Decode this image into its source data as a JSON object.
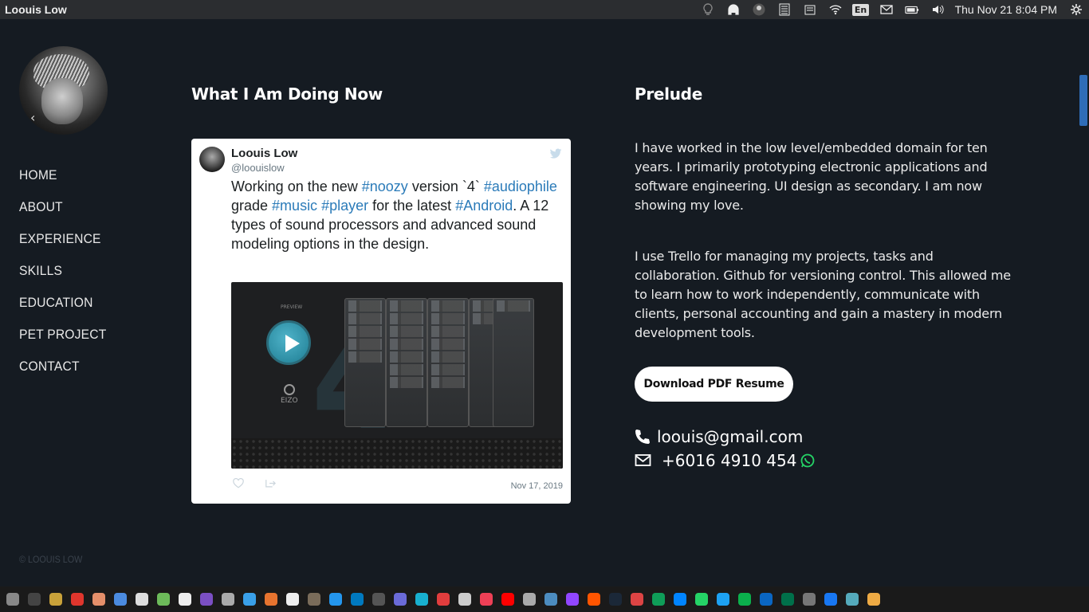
{
  "panel": {
    "title": "Loouis Low",
    "clock": "Thu Nov 21  8:04 PM",
    "lang": "En",
    "tray_icons": [
      "bulb-icon",
      "headphones-icon",
      "user-avatar-icon",
      "notes-icon",
      "clipboard-icon",
      "wifi-icon",
      "keyboard-layout-icon",
      "mail-icon",
      "battery-icon",
      "volume-icon",
      "settings-icon"
    ]
  },
  "sidebar": {
    "nav": [
      "HOME",
      "ABOUT",
      "EXPERIENCE",
      "SKILLS",
      "EDUCATION",
      "PET PROJECT",
      "CONTACT"
    ],
    "copyright": "© LOOUIS LOW"
  },
  "now": {
    "heading": "What I Am Doing Now",
    "tweet": {
      "name": "Loouis Low",
      "handle": "@loouislow",
      "text_parts": [
        {
          "t": "Working on the new ",
          "tag": false
        },
        {
          "t": "#noozy",
          "tag": true
        },
        {
          "t": " version `4` ",
          "tag": false
        },
        {
          "t": "#audiophile",
          "tag": true
        },
        {
          "t": " grade ",
          "tag": false
        },
        {
          "t": "#music",
          "tag": true
        },
        {
          "t": " ",
          "tag": false
        },
        {
          "t": "#player",
          "tag": true
        },
        {
          "t": " for the latest ",
          "tag": false
        },
        {
          "t": "#Android",
          "tag": true
        },
        {
          "t": ". A 12 types of sound processors and advanced sound modeling options in the design.",
          "tag": false
        }
      ],
      "media_label_preview": "PREVIEW",
      "media_label_brand": "EIZO",
      "media_big_numeral": "4",
      "date": "Nov 17, 2019"
    }
  },
  "prelude": {
    "heading": "Prelude",
    "para1": "I have worked in the low level/embedded domain for ten years. I primarily prototyping electronic applications and software engineering. UI design as secondary. I am now showing my love.",
    "para2": "I use Trello for managing my projects, tasks and collaboration. Github for versioning control. This allowed me to learn how to work independently, communicate with clients, personal accounting and gain a mastery in modern development tools.",
    "button": "Download PDF Resume",
    "email": "loouis@gmail.com",
    "phone": "+6016 4910 454"
  },
  "colors": {
    "background": "#151b22",
    "hashtag": "#2b7bb9",
    "whatsapp": "#25d366",
    "scroll_thumb": "#2f6db8"
  },
  "dock": {
    "apps": [
      "settings-icon",
      "terminal-icon",
      "files-icon",
      "opera-icon",
      "app-icon",
      "chrome-icon",
      "headphones-icon",
      "android-studio-icon",
      "editor-icon",
      "tor-icon",
      "tools-icon",
      "box-icon",
      "brave-icon",
      "github-icon",
      "gimp-icon",
      "docker-icon",
      "trello-icon",
      "app-icon",
      "app-icon",
      "play-icon",
      "news-icon",
      "app-icon",
      "pocket-icon",
      "youtube-icon",
      "webcam-icon",
      "media-icon",
      "twitch-icon",
      "soundcloud-icon",
      "steam-icon",
      "mail-icon",
      "hangouts-icon",
      "messenger-icon",
      "whatsapp-icon",
      "twitter-icon",
      "chat-icon",
      "linkedin-icon",
      "starbucks-icon",
      "app-icon",
      "facebook-icon",
      "app-icon",
      "app-icon"
    ]
  }
}
